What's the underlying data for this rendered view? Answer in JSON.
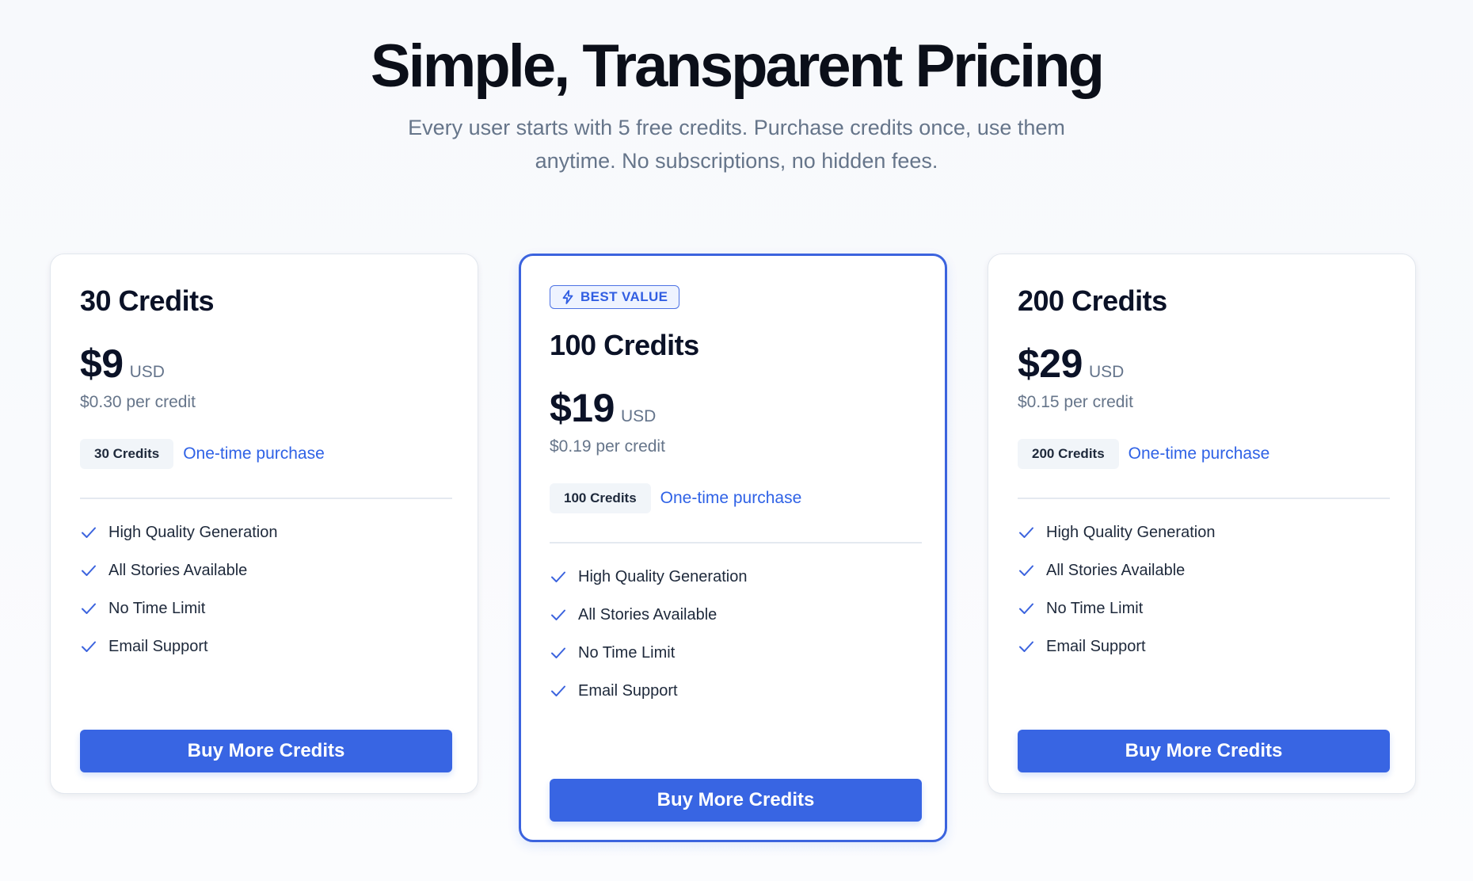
{
  "header": {
    "title": "Simple, Transparent Pricing",
    "subtitle": "Every user starts with 5 free credits. Purchase credits once, use them anytime. No subscriptions, no hidden fees."
  },
  "plans": [
    {
      "name": "30 Credits",
      "price": "$9",
      "currency": "USD",
      "per_credit": "$0.30 per credit",
      "credits_chip": "30 Credits",
      "purchase_type": "One-time purchase",
      "features": [
        "High Quality Generation",
        "All Stories Available",
        "No Time Limit",
        "Email Support"
      ],
      "cta": "Buy More Credits"
    },
    {
      "badge": "BEST VALUE",
      "name": "100 Credits",
      "price": "$19",
      "currency": "USD",
      "per_credit": "$0.19 per credit",
      "credits_chip": "100 Credits",
      "purchase_type": "One-time purchase",
      "features": [
        "High Quality Generation",
        "All Stories Available",
        "No Time Limit",
        "Email Support"
      ],
      "cta": "Buy More Credits"
    },
    {
      "name": "200 Credits",
      "price": "$29",
      "currency": "USD",
      "per_credit": "$0.15 per credit",
      "credits_chip": "200 Credits",
      "purchase_type": "One-time purchase",
      "features": [
        "High Quality Generation",
        "All Stories Available",
        "No Time Limit",
        "Email Support"
      ],
      "cta": "Buy More Credits"
    }
  ],
  "colors": {
    "accent": "#3865e3",
    "accent_text": "#2f62e6",
    "heading": "#0b1227",
    "muted": "#66758a"
  },
  "icons": {
    "badge": "lightning-icon",
    "feature": "check-icon"
  }
}
